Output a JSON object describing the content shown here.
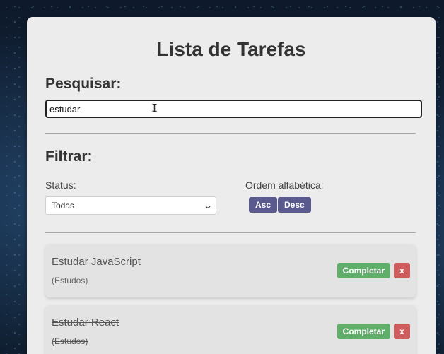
{
  "header": {
    "title": "Lista de Tarefas"
  },
  "search": {
    "heading": "Pesquisar:",
    "value": "estudar"
  },
  "filter": {
    "heading": "Filtrar:",
    "status_label": "Status:",
    "status_selected": "Todas",
    "order_label": "Ordem alfabética:",
    "asc_label": "Asc",
    "desc_label": "Desc"
  },
  "todos": [
    {
      "title": "Estudar JavaScript",
      "category": "(Estudos)",
      "completed": false,
      "complete_label": "Completar",
      "remove_label": "x"
    },
    {
      "title": "Estudar React",
      "category": "(Estudos)",
      "completed": true,
      "complete_label": "Completar",
      "remove_label": "x"
    }
  ],
  "colors": {
    "card_bg": "#ececec",
    "sort_button": "#5a5a8f",
    "complete_button": "#5fae6a",
    "remove_button": "#cf5c5c"
  },
  "icons": {
    "select_arrow": "chevron-down-icon",
    "text_cursor": "i-beam-cursor-icon"
  }
}
